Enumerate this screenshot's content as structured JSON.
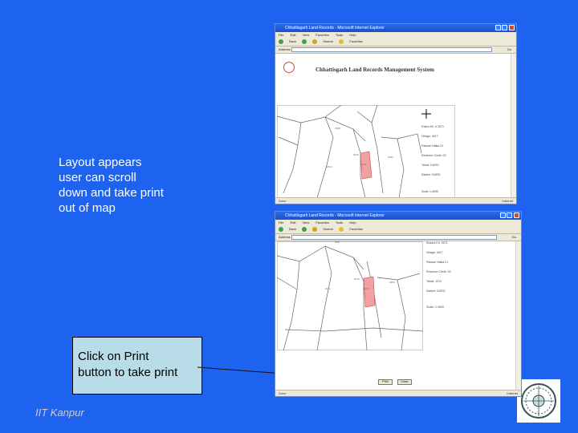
{
  "slide": {
    "caption": "Layout appears\nuser can scroll\ndown and take print\nout of map",
    "callout": "Click on Print\nbutton to take print",
    "footer": "IIT Kanpur",
    "logo_icon": "iit-kanpur-seal"
  },
  "browser": {
    "menu": [
      "File",
      "Edit",
      "View",
      "Favorites",
      "Tools",
      "Help"
    ],
    "toolbar": [
      "Back",
      "Search",
      "Favorites"
    ],
    "address_label": "Address",
    "go_label": "Go",
    "status_done": "Done",
    "status_zone": "Internet"
  },
  "window1": {
    "title": "Chhattisgarh Land Records - Microsoft Internet Explorer",
    "app_title": "Chhattisgarh Land Records Management System",
    "info": [
      "Rasra Kh. # 2071",
      "Village: 4017",
      "Patwari Halka 21",
      "Revenue Circle: 02",
      "Tahsil: DURG",
      "District: DURG",
      "Scale 1:4000"
    ]
  },
  "window2": {
    "title": "Chhattisgarh Land Records - Microsoft Internet Explorer",
    "info": [
      "Khasra Kh. 2071",
      "Village: 4017",
      "Patwari Halka 21",
      "Revenue Circle: 02",
      "Tahsil: 1372",
      "District: DURG",
      "Scale: 1:4000"
    ],
    "print_label": "Print",
    "close_label": "Close"
  }
}
